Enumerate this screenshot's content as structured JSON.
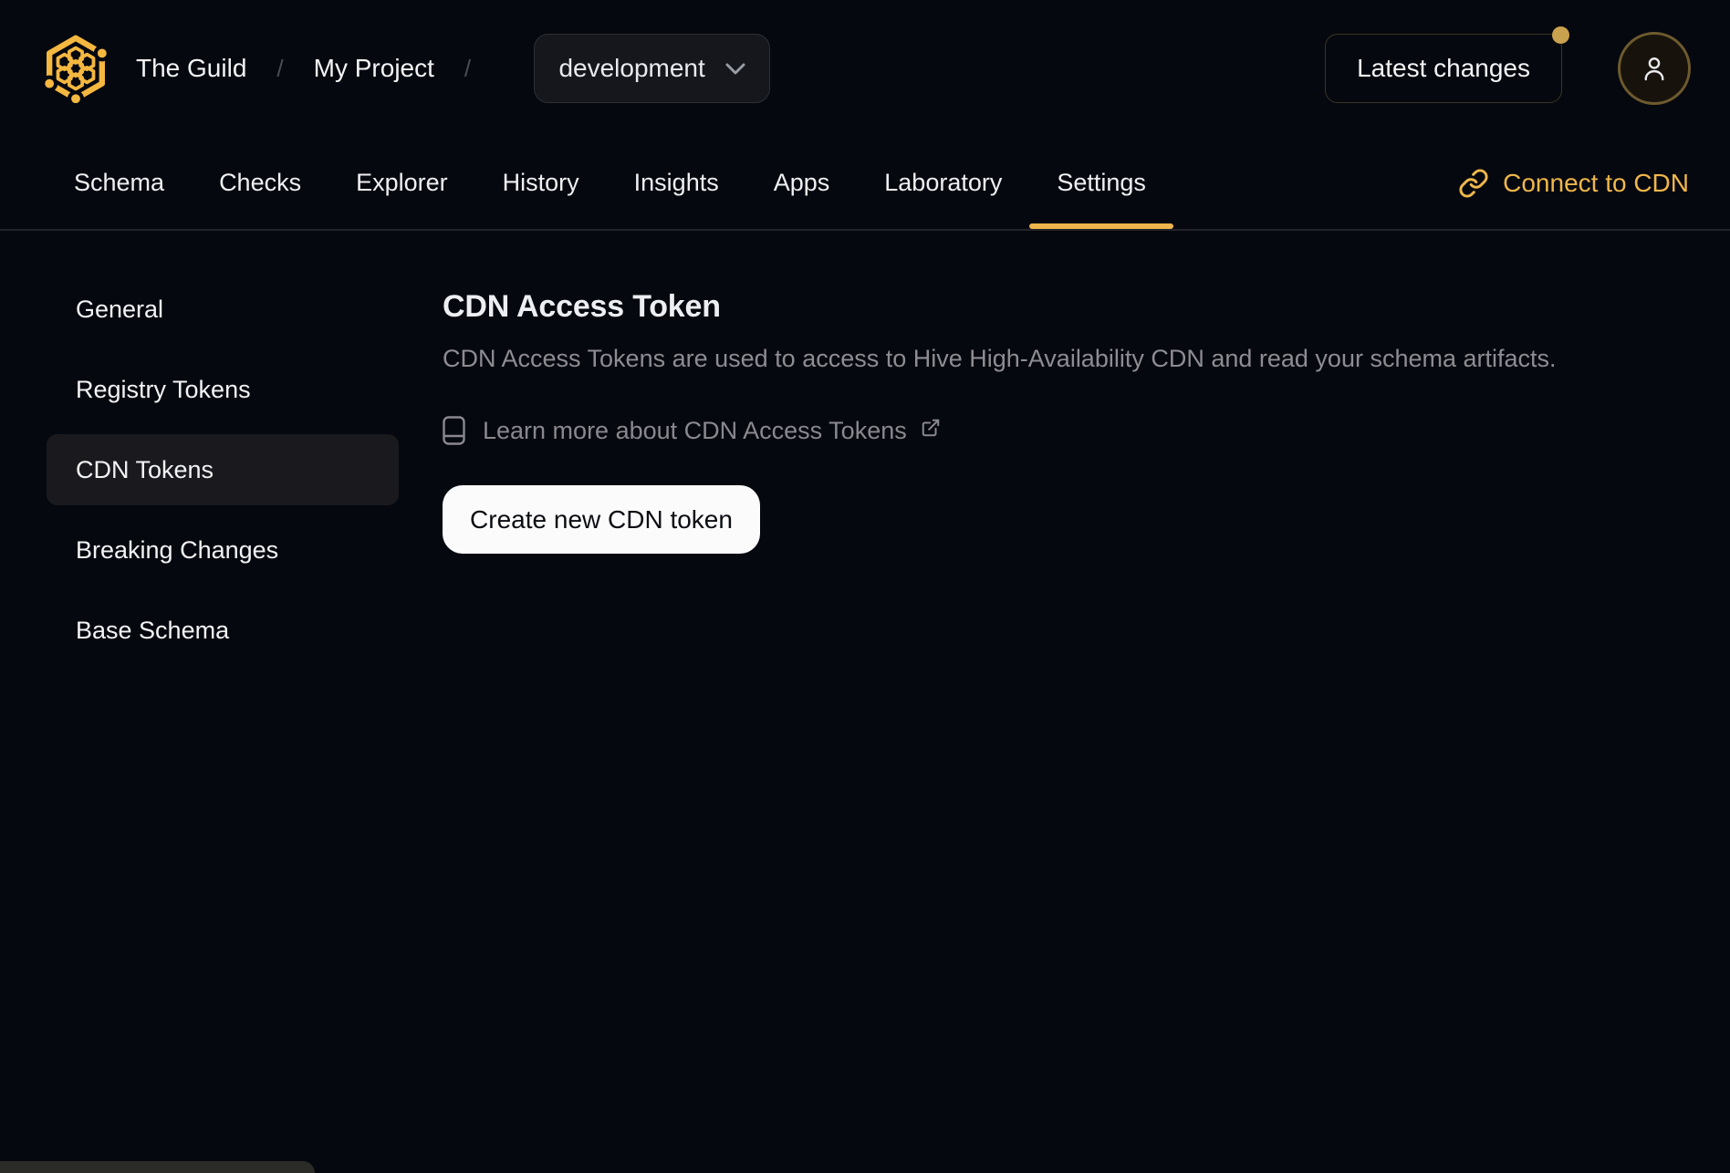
{
  "header": {
    "logo_name": "hive-honeycomb-logo",
    "breadcrumb": {
      "org": "The Guild",
      "separator": "/",
      "project": "My Project"
    },
    "target_selector": {
      "value": "development"
    },
    "latest_changes_label": "Latest changes",
    "notification_dot": true
  },
  "nav": {
    "tabs": [
      {
        "label": "Schema",
        "active": false
      },
      {
        "label": "Checks",
        "active": false
      },
      {
        "label": "Explorer",
        "active": false
      },
      {
        "label": "History",
        "active": false
      },
      {
        "label": "Insights",
        "active": false
      },
      {
        "label": "Apps",
        "active": false
      },
      {
        "label": "Laboratory",
        "active": false
      },
      {
        "label": "Settings",
        "active": true
      }
    ],
    "connect_cdn_label": "Connect to CDN"
  },
  "sidebar": {
    "items": [
      {
        "label": "General",
        "active": false
      },
      {
        "label": "Registry Tokens",
        "active": false
      },
      {
        "label": "CDN Tokens",
        "active": true
      },
      {
        "label": "Breaking Changes",
        "active": false
      },
      {
        "label": "Base Schema",
        "active": false
      }
    ]
  },
  "main": {
    "title": "CDN Access Token",
    "description": "CDN Access Tokens are used to access to Hive High-Availability CDN and read your schema artifacts.",
    "learn_more_label": "Learn more about CDN Access Tokens",
    "create_button_label": "Create new CDN token"
  },
  "icons": {
    "logo": "hive-honeycomb-logo",
    "chevron": "chevron-down-icon",
    "user": "user-icon",
    "link": "chain-link-icon",
    "book": "book-icon",
    "external": "external-link-icon"
  },
  "colors": {
    "background": "#06080f",
    "accent_gold": "#f4b740",
    "tab_underline": "#edb54b",
    "connect_link": "#efb74a",
    "notification_dot": "#c9a250",
    "avatar_ring": "#6d5a2e",
    "muted_text": "#8e8c93",
    "sidebar_active_bg": "#1a1a1e",
    "button_bg": "#fbfbfc",
    "button_text": "#0b0d12"
  }
}
